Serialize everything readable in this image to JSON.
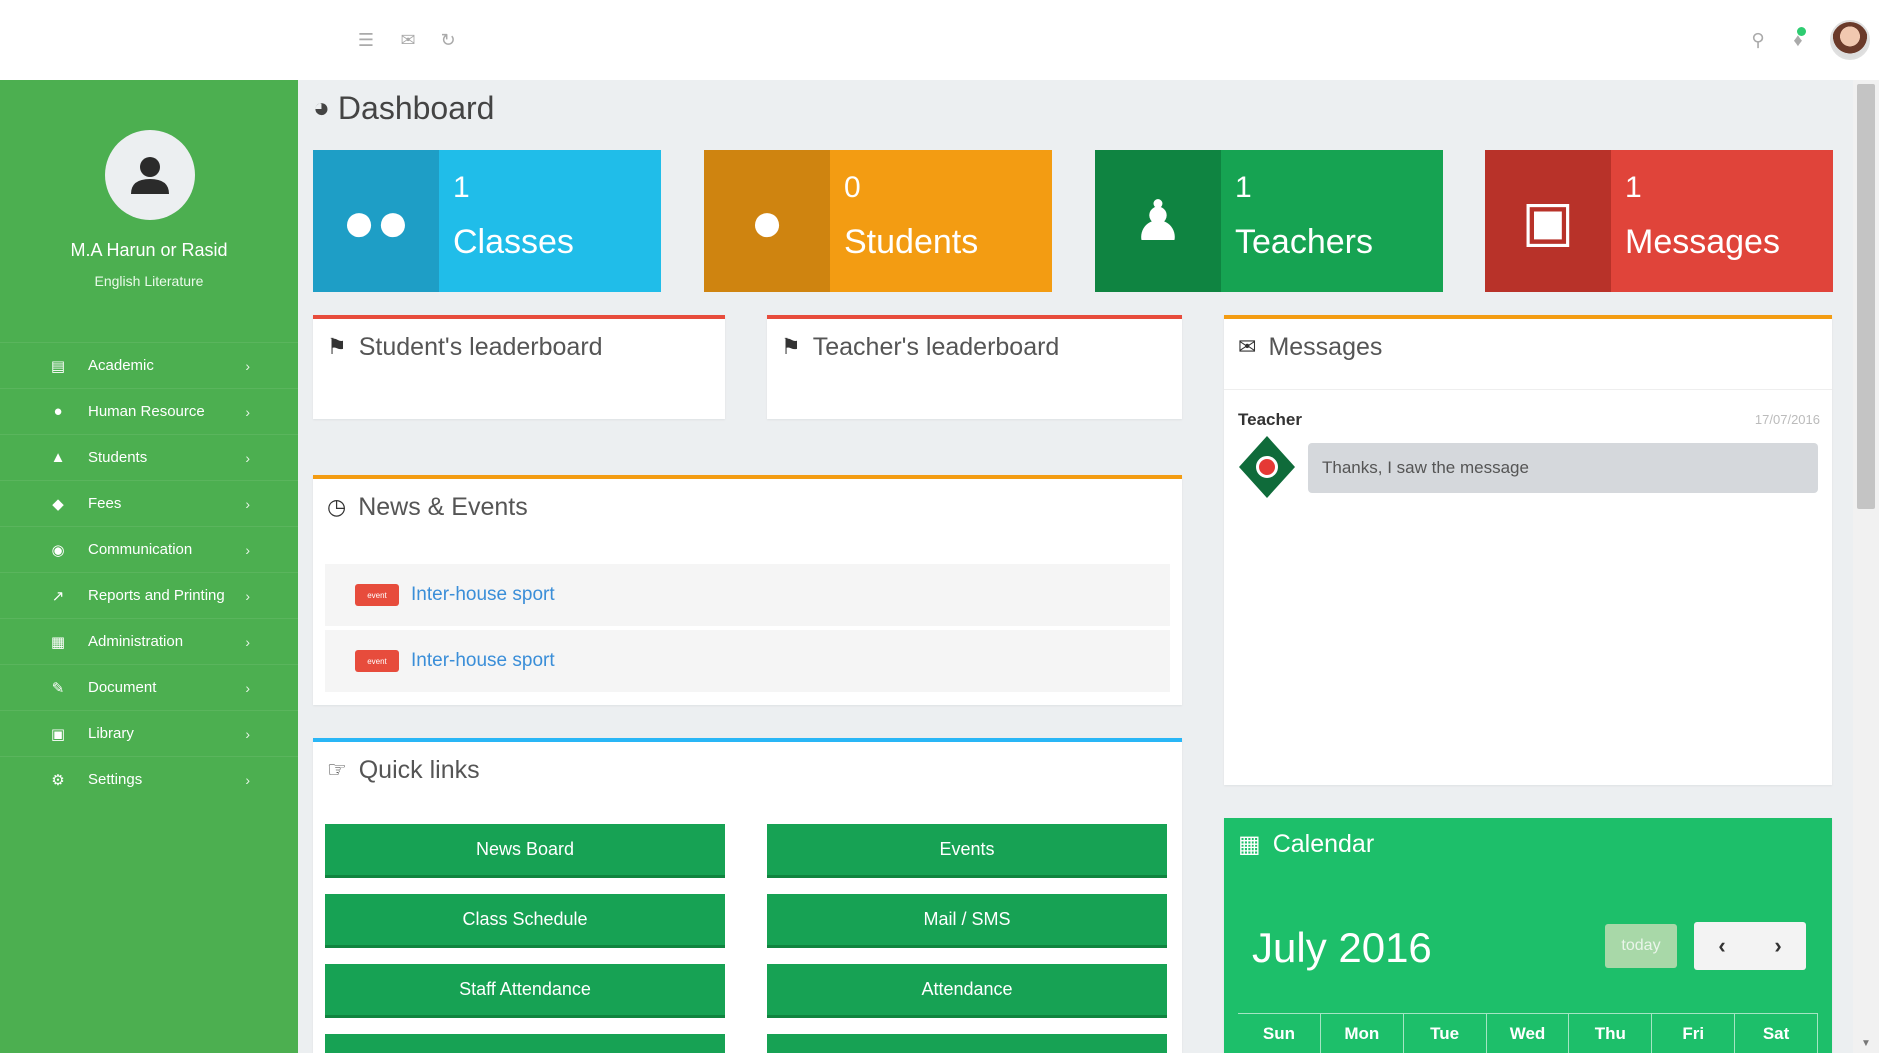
{
  "profile": {
    "name": "M.A Harun or Rasid",
    "department": "English Literature"
  },
  "sidebar": {
    "items": [
      {
        "label": "Academic",
        "icon": "book-icon"
      },
      {
        "label": "Human Resource",
        "icon": "head-icon"
      },
      {
        "label": "Students",
        "icon": "reader-icon"
      },
      {
        "label": "Fees",
        "icon": "money-icon"
      },
      {
        "label": "Communication",
        "icon": "chat-icon"
      },
      {
        "label": "Reports and Printing",
        "icon": "chart-icon"
      },
      {
        "label": "Administration",
        "icon": "document-icon"
      },
      {
        "label": "Document",
        "icon": "edit-icon"
      },
      {
        "label": "Library",
        "icon": "bank-icon"
      },
      {
        "label": "Settings",
        "icon": "gear-icon"
      }
    ]
  },
  "page": {
    "title": "Dashboard"
  },
  "stats": [
    {
      "count": "1",
      "label": "Classes"
    },
    {
      "count": "0",
      "label": "Students"
    },
    {
      "count": "1",
      "label": "Teachers"
    },
    {
      "count": "1",
      "label": "Messages"
    }
  ],
  "panels": {
    "student_leaderboard": "Student's leaderboard",
    "teacher_leaderboard": "Teacher's leaderboard",
    "messages": "Messages",
    "news": "News & Events",
    "quick_links": "Quick links",
    "calendar": "Calendar"
  },
  "message": {
    "sender": "Teacher",
    "date": "17/07/2016",
    "text": "Thanks, I saw the message"
  },
  "news": [
    {
      "badge": "event",
      "title": "Inter-house sport"
    },
    {
      "badge": "event",
      "title": "Inter-house sport"
    }
  ],
  "quick_links": [
    "News Board",
    "Events",
    "Class Schedule",
    "Mail / SMS",
    "Staff Attendance",
    "Attendance",
    "",
    ""
  ],
  "calendar": {
    "month": "July 2016",
    "today_label": "today",
    "days": [
      "Sun",
      "Mon",
      "Tue",
      "Wed",
      "Thu",
      "Fri",
      "Sat"
    ]
  },
  "colors": {
    "sidebar": "#4caf50",
    "classes": "#20bde9",
    "students": "#f39c12",
    "teachers": "#16a352",
    "messages": "#e0443a",
    "calendar": "#1dbf6a",
    "quick_link": "#17a254"
  }
}
